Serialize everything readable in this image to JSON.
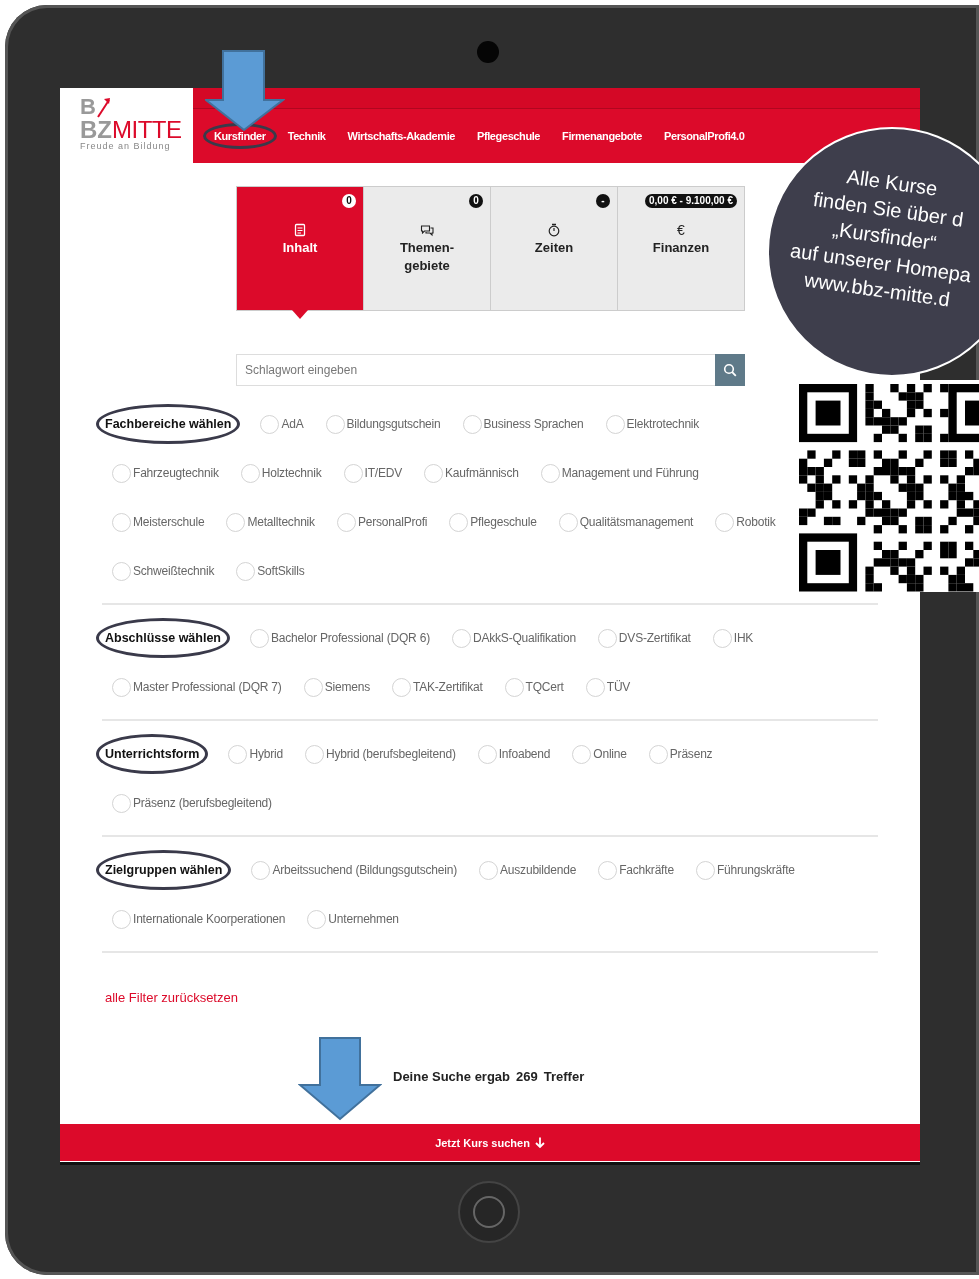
{
  "logo": {
    "letter": "B",
    "grey_part": "BZ",
    "red_part": "MITTE",
    "tagline": "Freude an Bildung"
  },
  "nav": [
    {
      "label": "Kursfinder",
      "annotated": true
    },
    {
      "label": "Technik",
      "annotated": false
    },
    {
      "label": "Wirtschafts-Akademie",
      "annotated": false
    },
    {
      "label": "Pflegeschule",
      "annotated": false
    },
    {
      "label": "Firmenangebote",
      "annotated": false
    },
    {
      "label": "PersonalProfi4.0",
      "annotated": false
    }
  ],
  "filter_tabs": [
    {
      "kind": "document",
      "label": "Inhalt",
      "badge": "0",
      "selected": true
    },
    {
      "kind": "chat",
      "label": "Themen-\ngebiete",
      "badge": "0",
      "selected": false
    },
    {
      "kind": "stopwatch",
      "label": "Zeiten",
      "badge": "-",
      "selected": false
    },
    {
      "kind": "symbol",
      "symbol": "€",
      "label": "Finanzen",
      "badge": "0,00 € - 9.100,00 €",
      "selected": false
    }
  ],
  "search": {
    "placeholder": "Schlagwort eingeben"
  },
  "filter_groups": [
    {
      "label": "Fachbereiche wählen",
      "annotated": true,
      "options": [
        {
          "label": "AdA",
          "checked": false
        },
        {
          "label": "Bildungsgutschein",
          "checked": false
        },
        {
          "label": "Business Sprachen",
          "checked": false
        },
        {
          "label": "Elektrotechnik",
          "checked": false
        },
        {
          "label": "Fahrzeugtechnik",
          "checked": false
        },
        {
          "label": "Holztechnik",
          "checked": false
        },
        {
          "label": "IT/EDV",
          "checked": false
        },
        {
          "label": "Kaufmännisch",
          "checked": false
        },
        {
          "label": "Management und Führung",
          "checked": false
        },
        {
          "label": "Meisterschule",
          "checked": false
        },
        {
          "label": "Metalltechnik",
          "checked": false
        },
        {
          "label": "PersonalProfi",
          "checked": false
        },
        {
          "label": "Pflegeschule",
          "checked": false
        },
        {
          "label": "Qualitätsmanagement",
          "checked": false
        },
        {
          "label": "Robotik",
          "checked": false
        },
        {
          "label": "Schweißtechnik",
          "checked": false
        },
        {
          "label": "SoftSkills",
          "checked": false
        }
      ]
    },
    {
      "label": "Abschlüsse wählen",
      "annotated": true,
      "options": [
        {
          "label": "Bachelor Professional (DQR 6)",
          "checked": false
        },
        {
          "label": "DAkkS-Qualifikation",
          "checked": false
        },
        {
          "label": "DVS-Zertifikat",
          "checked": false
        },
        {
          "label": "IHK",
          "checked": false
        },
        {
          "label": "Master Professional (DQR 7)",
          "checked": false
        },
        {
          "label": "Siemens",
          "checked": false
        },
        {
          "label": "TAK-Zertifikat",
          "checked": false
        },
        {
          "label": "TQCert",
          "checked": false
        },
        {
          "label": "TÜV",
          "checked": false
        }
      ]
    },
    {
      "label": "Unterrichtsform",
      "annotated": true,
      "options": [
        {
          "label": "Hybrid",
          "checked": false
        },
        {
          "label": "Hybrid (berufsbegleitend)",
          "checked": false
        },
        {
          "label": "Infoabend",
          "checked": false
        },
        {
          "label": "Online",
          "checked": false
        },
        {
          "label": "Präsenz",
          "checked": false
        },
        {
          "label": "Präsenz (berufsbegleitend)",
          "checked": false
        }
      ]
    },
    {
      "label": "Zielgruppen wählen",
      "annotated": true,
      "options": [
        {
          "label": "Arbeitssuchend (Bildungsgutschein)",
          "checked": false
        },
        {
          "label": "Auszubildende",
          "checked": false
        },
        {
          "label": "Fachkräfte",
          "checked": false
        },
        {
          "label": "Führungskräfte",
          "checked": false
        },
        {
          "label": "Internationale Koorperationen",
          "checked": false
        },
        {
          "label": "Unternehmen",
          "checked": false
        }
      ]
    }
  ],
  "reset_link": "alle Filter zurücksetzen",
  "result": {
    "prefix": "Deine Suche ergab",
    "count": "269",
    "suffix": "Treffer"
  },
  "submit_button": "Jetzt Kurs suchen",
  "promo_bubble": {
    "lines": [
      "Alle Kurse",
      "finden Sie über d",
      "„Kursfinder“",
      "auf unserer Homepa",
      "www.bbz-mitte.d"
    ]
  }
}
